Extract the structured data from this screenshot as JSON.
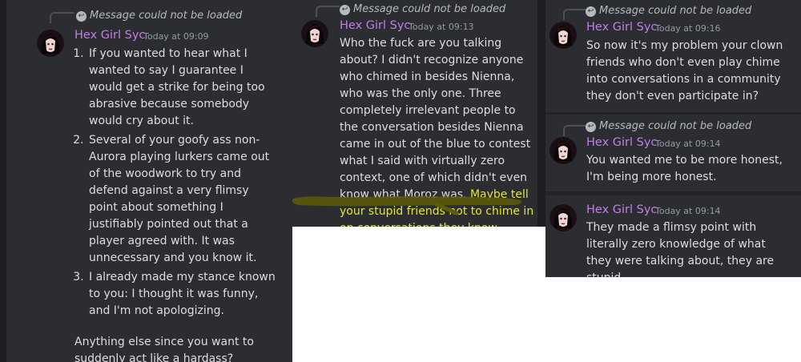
{
  "reply_text": "Message could not be loaded",
  "username": "Hex Girl Syc",
  "colors": {
    "panel": "#2b2d31",
    "username": "#c27ee8",
    "text": "#dbdee1",
    "muted": "#949ba4",
    "highlight": "#e6e62a",
    "marker": "#5d5d08"
  },
  "msg1": {
    "time": "Today at 09:09",
    "items": [
      "If you wanted to hear what I wanted to say I guarantee I would get a strike for being too abrasive because somebody would cry about it.",
      "Several of your goofy ass non-Aurora playing lurkers came out of the woodwork to try and defend against a very flimsy point about something I justifiably pointed out that a player agreed with. It was unnecessary and you know it.",
      "I already made my stance known to you: I thought it was funny, and I'm not apologizing."
    ],
    "after": "Anything else since you want to suddenly act like a hardass?"
  },
  "msg2": {
    "time": "Today at 09:13",
    "text": "Who the fuck are you talking about? I didn't recognize anyone who chimed in besides Nienna, who was the only one. Three completely irrelevant people to the conversation besides Nienna came in out of the blue to contest what I said with virtually zero context, one of which didn't even know what Moroz was. ",
    "highlighted": "Maybe tell your stupid friends not to chime in on conversations they know nothing about."
  },
  "msg3": {
    "time": "Today at 09:16",
    "text": "So now it's my problem your clown friends who don't even play chime into conversations in a community they don't even participate in?"
  },
  "msg4": {
    "time": "Today at 09:14",
    "text": "You wanted me to be more honest, I'm being more honest."
  },
  "msg5": {
    "time": "Today at 09:14",
    "text": "They made a flimsy point with literally zero knowledge of what they were talking about, they are stupid."
  }
}
